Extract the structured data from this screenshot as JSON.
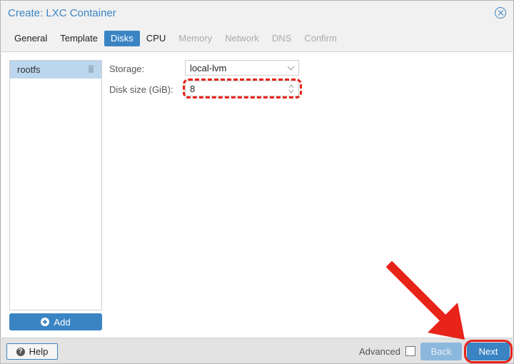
{
  "window": {
    "title": "Create: LXC Container"
  },
  "tabs": [
    {
      "label": "General",
      "state": "enabled"
    },
    {
      "label": "Template",
      "state": "enabled"
    },
    {
      "label": "Disks",
      "state": "active"
    },
    {
      "label": "CPU",
      "state": "enabled"
    },
    {
      "label": "Memory",
      "state": "disabled"
    },
    {
      "label": "Network",
      "state": "disabled"
    },
    {
      "label": "DNS",
      "state": "disabled"
    },
    {
      "label": "Confirm",
      "state": "disabled"
    }
  ],
  "disks": {
    "items": [
      {
        "label": "rootfs"
      }
    ],
    "add_label": "Add"
  },
  "form": {
    "storage_label": "Storage:",
    "storage_value": "local-lvm",
    "disk_size_label": "Disk size (GiB):",
    "disk_size_value": "8"
  },
  "footer": {
    "help_label": "Help",
    "advanced_label": "Advanced",
    "advanced_checked": false,
    "back_label": "Back",
    "next_label": "Next"
  },
  "annotations": {
    "color": "#e8231a"
  }
}
